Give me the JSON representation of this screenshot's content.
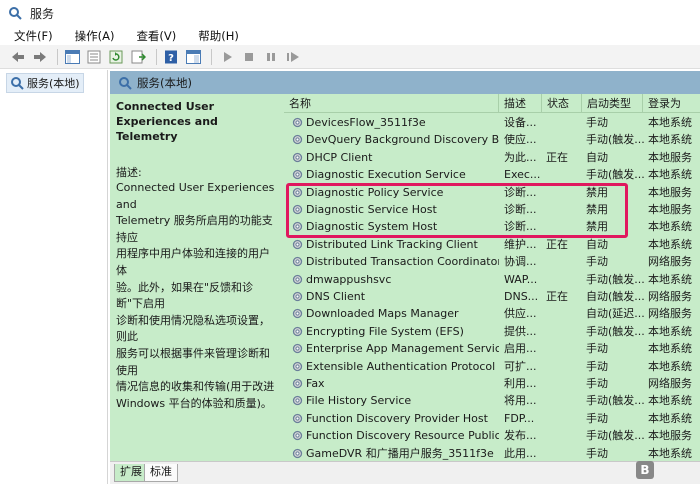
{
  "window": {
    "title": "服务",
    "icon": "services-gear-icon"
  },
  "menu": [
    "文件(F)",
    "操作(A)",
    "查看(V)",
    "帮助(H)"
  ],
  "toolbar": [
    "back-arrow-icon",
    "forward-arrow-icon",
    "show-console-tree-icon",
    "properties-icon",
    "refresh-icon",
    "export-list-icon",
    "help-icon",
    "console-icon",
    "start-service-icon",
    "stop-service-icon",
    "pause-service-icon",
    "restart-service-icon"
  ],
  "tree": {
    "item_label": "服务(本地)"
  },
  "panel_header": {
    "label": "服务(本地)"
  },
  "description_panel": {
    "title": "Connected User Experiences and Telemetry",
    "label": "描述:",
    "lines": [
      "Connected User Experiences and",
      "Telemetry 服务所启用的功能支持应",
      "用程序中用户体验和连接的用户体",
      "验。此外，如果在\"反馈和诊断\"下启用",
      "诊断和使用情况隐私选项设置，则此",
      "服务可以根据事件来管理诊断和使用",
      "情况信息的收集和传输(用于改进",
      "Windows 平台的体验和质量)。"
    ]
  },
  "columns": {
    "name": "名称",
    "description": "描述",
    "status": "状态",
    "startup": "启动类型",
    "logon": "登录为"
  },
  "services": [
    {
      "name": "DevicesFlow_3511f3e",
      "description": "设备...",
      "status": "",
      "startup": "手动",
      "logon": "本地系统"
    },
    {
      "name": "DevQuery Background Discovery Bro",
      "description": "使应...",
      "status": "",
      "startup": "手动(触发...",
      "logon": "本地系统"
    },
    {
      "name": "DHCP Client",
      "description": "为此...",
      "status": "正在",
      "startup": "自动",
      "logon": "本地服务"
    },
    {
      "name": "Diagnostic Execution Service",
      "description": "Exec...",
      "status": "",
      "startup": "手动(触发...",
      "logon": "本地系统"
    },
    {
      "name": "Diagnostic Policy Service",
      "description": "诊断...",
      "status": "",
      "startup": "禁用",
      "logon": "本地服务"
    },
    {
      "name": "Diagnostic Service Host",
      "description": "诊断...",
      "status": "",
      "startup": "禁用",
      "logon": "本地服务"
    },
    {
      "name": "Diagnostic System Host",
      "description": "诊断...",
      "status": "",
      "startup": "禁用",
      "logon": "本地系统"
    },
    {
      "name": "Distributed Link Tracking Client",
      "description": "维护...",
      "status": "正在",
      "startup": "自动",
      "logon": "本地系统"
    },
    {
      "name": "Distributed Transaction Coordinator",
      "description": "协调...",
      "status": "",
      "startup": "手动",
      "logon": "网络服务"
    },
    {
      "name": "dmwappushsvc",
      "description": "WAP...",
      "status": "",
      "startup": "手动(触发...",
      "logon": "本地系统"
    },
    {
      "name": "DNS Client",
      "description": "DNS...",
      "status": "正在",
      "startup": "自动(触发...",
      "logon": "网络服务"
    },
    {
      "name": "Downloaded Maps Manager",
      "description": "供应...",
      "status": "",
      "startup": "自动(延迟...",
      "logon": "网络服务"
    },
    {
      "name": "Encrypting File System (EFS)",
      "description": "提供...",
      "status": "",
      "startup": "手动(触发...",
      "logon": "本地系统"
    },
    {
      "name": "Enterprise App Management Service",
      "description": "启用...",
      "status": "",
      "startup": "手动",
      "logon": "本地系统"
    },
    {
      "name": "Extensible Authentication Protocol",
      "description": "可扩...",
      "status": "",
      "startup": "手动",
      "logon": "本地系统"
    },
    {
      "name": "Fax",
      "description": "利用...",
      "status": "",
      "startup": "手动",
      "logon": "网络服务"
    },
    {
      "name": "File History Service",
      "description": "将用...",
      "status": "",
      "startup": "手动(触发...",
      "logon": "本地系统"
    },
    {
      "name": "Function Discovery Provider Host",
      "description": "FDP...",
      "status": "",
      "startup": "手动",
      "logon": "本地系统"
    },
    {
      "name": "Function Discovery Resource Publicati",
      "description": "发布...",
      "status": "",
      "startup": "手动(触发...",
      "logon": "本地服务"
    },
    {
      "name": "GameDVR 和广播用户服务_3511f3e",
      "description": "此用...",
      "status": "",
      "startup": "手动",
      "logon": "本地系统"
    }
  ],
  "highlight": {
    "color": "#e0185e"
  },
  "tabs": [
    "扩展",
    "标准"
  ],
  "watermark": {
    "logo_text": "B"
  }
}
